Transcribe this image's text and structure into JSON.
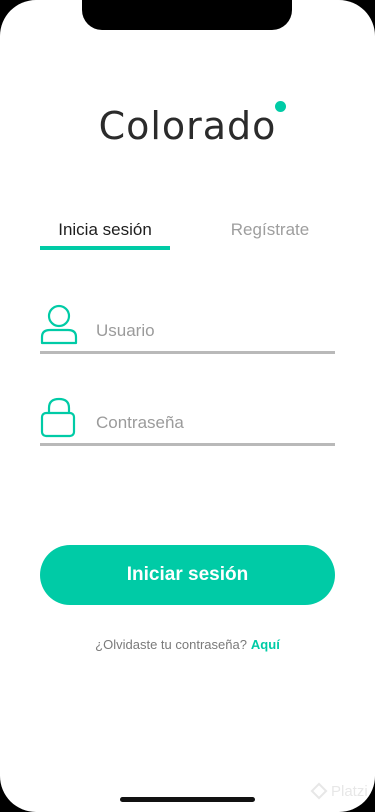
{
  "app": {
    "logo_text": "Colorado",
    "accent_color": "#00cba6"
  },
  "tabs": [
    {
      "label": "Inicia sesión",
      "active": true
    },
    {
      "label": "Regístrate",
      "active": false
    }
  ],
  "form": {
    "username": {
      "placeholder": "Usuario",
      "value": "",
      "icon": "user-icon"
    },
    "password": {
      "placeholder": "Contraseña",
      "value": "",
      "icon": "lock-icon"
    }
  },
  "actions": {
    "submit_label": "Iniciar sesión",
    "forgot_text": "¿Olvidaste tu contraseña?",
    "forgot_link": "Aquí"
  },
  "watermark": {
    "text": "Platzi"
  }
}
